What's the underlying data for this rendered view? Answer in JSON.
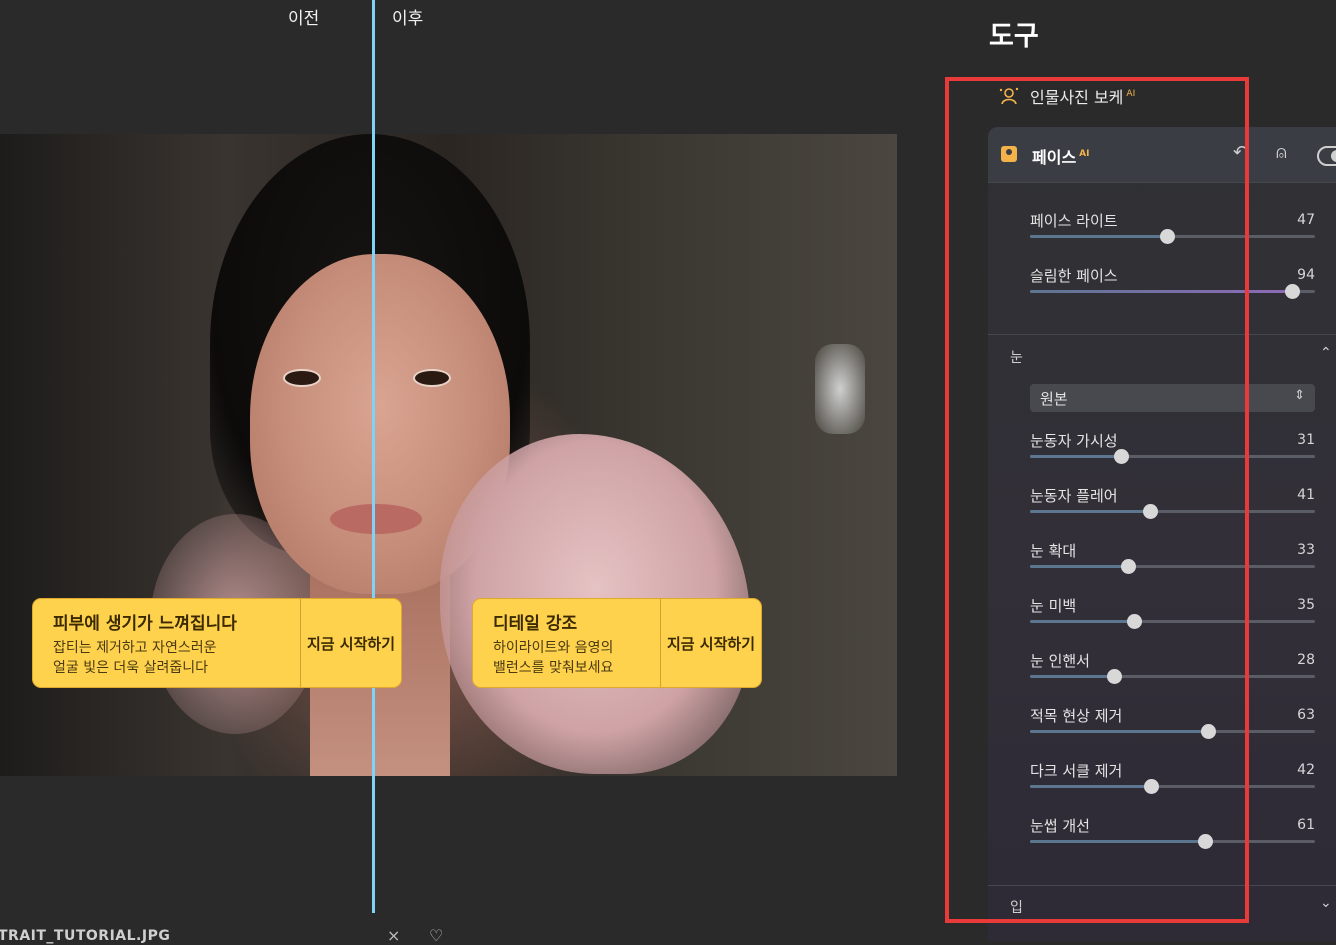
{
  "compare": {
    "before_label": "이전",
    "after_label": "이후"
  },
  "promo_cards": [
    {
      "title": "피부에 생기가 느껴집니다",
      "desc_line1": "잡티는 제거하고 자연스러운",
      "desc_line2": "얼굴 빛은 더욱 살려줍니다",
      "cta": "지금 시작하기"
    },
    {
      "title": "디테일 강조",
      "desc_line1": "하이라이트와 음영의",
      "desc_line2": "밸런스를 맞춰보세요",
      "cta": "지금 시작하기"
    }
  ],
  "footer": {
    "filename": "TRAIT_TUTORIAL.JPG",
    "close_icon": "×",
    "heart_icon": "♡"
  },
  "tools": {
    "title": "도구",
    "bokeh": {
      "label": "인물사진 보케",
      "badge": "AI"
    },
    "face_panel": {
      "title": "페이스",
      "badge": "AI",
      "accent_color": "#f3b34a",
      "sliders": [
        {
          "label": "페이스 라이트",
          "value": "47",
          "fraction": 0.48
        },
        {
          "label": "슬림한 페이스",
          "value": "94",
          "fraction": 0.92
        }
      ]
    },
    "eye_section": {
      "label": "눈",
      "select_value": "원본",
      "sliders": [
        {
          "label": "눈동자 가시성",
          "value": "31",
          "fraction": 0.32
        },
        {
          "label": "눈동자 플레어",
          "value": "41",
          "fraction": 0.42
        },
        {
          "label": "눈 확대",
          "value": "33",
          "fraction": 0.345
        },
        {
          "label": "눈 미백",
          "value": "35",
          "fraction": 0.365
        },
        {
          "label": "눈 인핸서",
          "value": "28",
          "fraction": 0.295
        },
        {
          "label": "적목 현상 제거",
          "value": "63",
          "fraction": 0.625
        },
        {
          "label": "다크 서클 제거",
          "value": "42",
          "fraction": 0.425
        },
        {
          "label": "눈썹 개선",
          "value": "61",
          "fraction": 0.615
        }
      ]
    },
    "mouth_section": {
      "label": "입"
    }
  },
  "highlight_color": "#e93a3a"
}
